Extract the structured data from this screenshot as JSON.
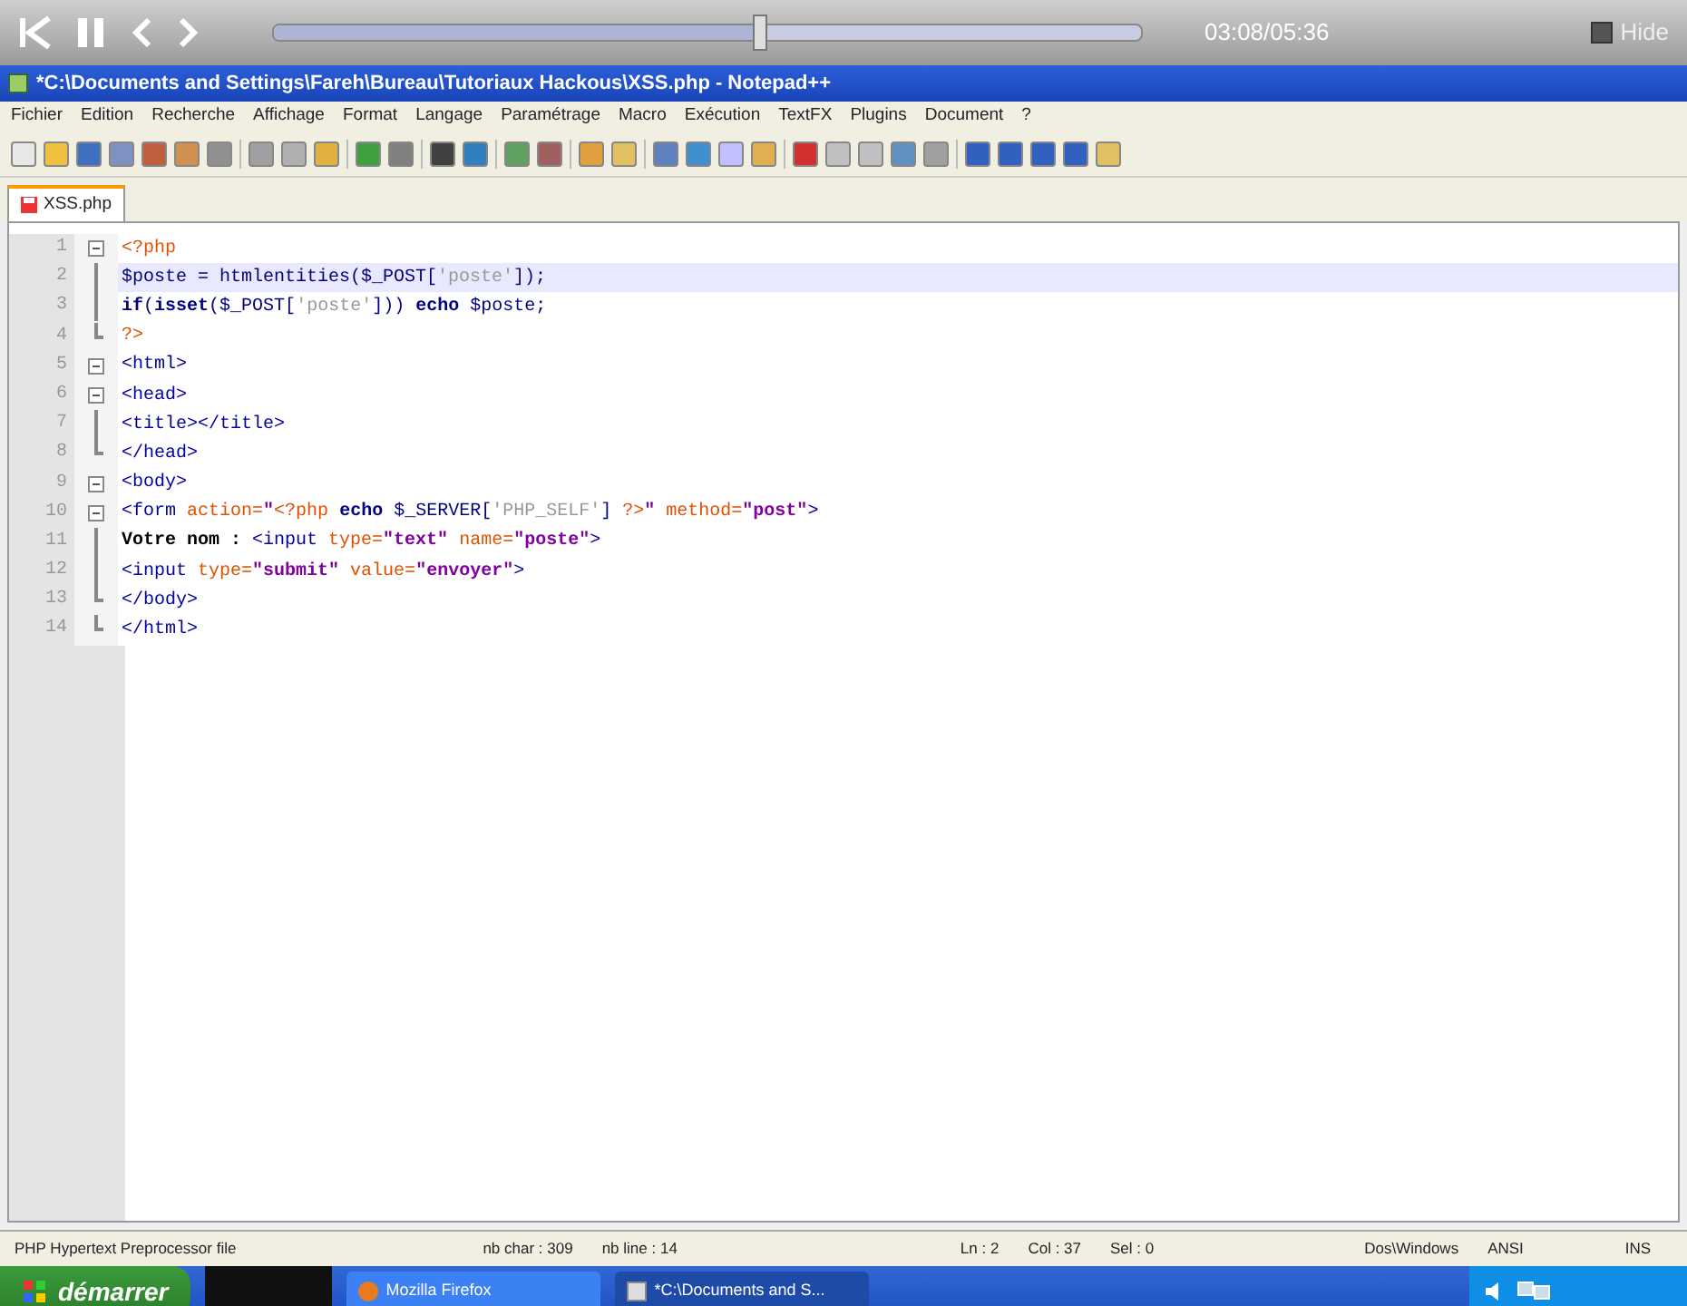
{
  "player": {
    "level": 0.56,
    "time": "03:08/05:36",
    "hide": {
      "label": "Hide",
      "checked": false
    }
  },
  "window": {
    "title": "*C:\\Documents and Settings\\Fareh\\Bureau\\Tutoriaux Hackous\\XSS.php - Notepad++"
  },
  "menu": [
    "Fichier",
    "Edition",
    "Recherche",
    "Affichage",
    "Format",
    "Langage",
    "Paramétrage",
    "Macro",
    "Exécution",
    "TextFX",
    "Plugins",
    "Document",
    "?"
  ],
  "tabs": [
    {
      "label": "XSS.php",
      "selected": true,
      "modified": true
    }
  ],
  "lines": [
    {
      "number": "1",
      "kind": "open",
      "current": false,
      "segments": [
        {
          "text": "<?php",
          "kind": "php"
        }
      ]
    },
    {
      "number": "2",
      "kind": "line",
      "current": true,
      "segments": [
        {
          "text": "$poste = htmlentities($_POST[",
          "kind": "plain"
        },
        {
          "text": "'poste'",
          "kind": "single"
        },
        {
          "text": "]);",
          "kind": "plain"
        }
      ]
    },
    {
      "number": "3",
      "kind": "line",
      "current": false,
      "segments": [
        {
          "text": "if",
          "kind": "keyword"
        },
        {
          "text": "(",
          "kind": "plain"
        },
        {
          "text": "isset",
          "kind": "keyword"
        },
        {
          "text": "($_POST[",
          "kind": "plain"
        },
        {
          "text": "'poste'",
          "kind": "single"
        },
        {
          "text": "])) ",
          "kind": "plain"
        },
        {
          "text": "echo",
          "kind": "keyword"
        },
        {
          "text": " $poste;",
          "kind": "plain"
        }
      ]
    },
    {
      "number": "4",
      "kind": "end",
      "current": false,
      "segments": [
        {
          "text": "?>",
          "kind": "php"
        }
      ]
    },
    {
      "number": "5",
      "kind": "open",
      "current": false,
      "segments": [
        {
          "text": "<html>",
          "kind": "tag"
        }
      ]
    },
    {
      "number": "6",
      "kind": "open",
      "current": false,
      "segments": [
        {
          "text": "<head>",
          "kind": "tag"
        }
      ]
    },
    {
      "number": "7",
      "kind": "line",
      "current": false,
      "segments": [
        {
          "text": "<title></title>",
          "kind": "tag"
        }
      ]
    },
    {
      "number": "8",
      "kind": "end",
      "current": false,
      "segments": [
        {
          "text": "</head>",
          "kind": "tag"
        }
      ]
    },
    {
      "number": "9",
      "kind": "open",
      "current": false,
      "segments": [
        {
          "text": "<body>",
          "kind": "tag"
        }
      ]
    },
    {
      "number": "10",
      "kind": "open",
      "current": false,
      "segments": [
        {
          "text": "<form ",
          "kind": "tag"
        },
        {
          "text": "action=",
          "kind": "attr"
        },
        {
          "text": "\"",
          "kind": "string"
        },
        {
          "text": "<?php ",
          "kind": "php"
        },
        {
          "text": "echo ",
          "kind": "keyword"
        },
        {
          "text": "$_SERVER[",
          "kind": "plain"
        },
        {
          "text": "'PHP_SELF'",
          "kind": "single"
        },
        {
          "text": "] ",
          "kind": "plain"
        },
        {
          "text": "?>",
          "kind": "php"
        },
        {
          "text": "\" ",
          "kind": "string"
        },
        {
          "text": "method=",
          "kind": "attr"
        },
        {
          "text": "\"post\"",
          "kind": "string"
        },
        {
          "text": ">",
          "kind": "tag"
        }
      ]
    },
    {
      "number": "11",
      "kind": "line",
      "current": false,
      "segments": [
        {
          "text": "Votre nom : ",
          "kind": "text"
        },
        {
          "text": "<input ",
          "kind": "tag"
        },
        {
          "text": "type=",
          "kind": "attr"
        },
        {
          "text": "\"text\"",
          "kind": "string"
        },
        {
          "text": " name=",
          "kind": "attr"
        },
        {
          "text": "\"poste\"",
          "kind": "string"
        },
        {
          "text": ">",
          "kind": "tag"
        }
      ]
    },
    {
      "number": "12",
      "kind": "line",
      "current": false,
      "segments": [
        {
          "text": "<input ",
          "kind": "tag"
        },
        {
          "text": "type=",
          "kind": "attr"
        },
        {
          "text": "\"submit\"",
          "kind": "string"
        },
        {
          "text": " value=",
          "kind": "attr"
        },
        {
          "text": "\"envoyer\"",
          "kind": "string"
        },
        {
          "text": ">",
          "kind": "tag"
        }
      ]
    },
    {
      "number": "13",
      "kind": "end",
      "current": false,
      "segments": [
        {
          "text": "</body>",
          "kind": "tag"
        }
      ]
    },
    {
      "number": "14",
      "kind": "end",
      "current": false,
      "segments": [
        {
          "text": "</html>",
          "kind": "tag"
        }
      ]
    }
  ],
  "status_bar": [
    "PHP Hypertext Preprocessor file",
    "nb char : 309",
    "nb line : 14",
    "Ln : 2",
    "Col : 37",
    "Sel : 0",
    "Dos\\Windows",
    "ANSI",
    "INS"
  ],
  "taskbar": {
    "start": "démarrer",
    "items": [
      {
        "label": "Mozilla Firefox",
        "selected": false
      },
      {
        "label": "*C:\\Documents and S...",
        "selected": true
      }
    ]
  }
}
